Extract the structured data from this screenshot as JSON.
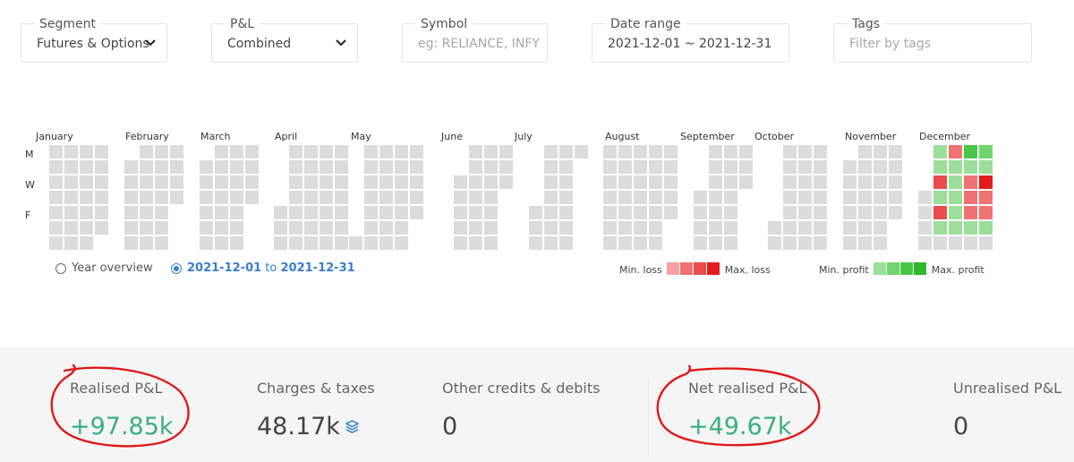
{
  "filters": {
    "segment": {
      "label": "Segment",
      "value": "Futures & Options"
    },
    "pnl": {
      "label": "P&L",
      "value": "Combined"
    },
    "symbol": {
      "label": "Symbol",
      "placeholder": "eg: RELIANCE, INFY"
    },
    "date_range": {
      "label": "Date range",
      "value": "2021-12-01 ~ 2021-12-31"
    },
    "tags": {
      "label": "Tags",
      "placeholder": "Filter by tags"
    }
  },
  "heatmap": {
    "months": [
      "January",
      "February",
      "March",
      "April",
      "May",
      "June",
      "July",
      "August",
      "September",
      "October",
      "November",
      "December"
    ],
    "day_labels": [
      "M",
      "W",
      "F"
    ],
    "empty_color": "#dcdcdc",
    "december_cells": [
      {
        "week": 1,
        "day": 0,
        "level": "p1"
      },
      {
        "week": 1,
        "day": 1,
        "level": "p1"
      },
      {
        "week": 1,
        "day": 2,
        "level": "l3"
      },
      {
        "week": 1,
        "day": 3,
        "level": "p1"
      },
      {
        "week": 1,
        "day": 4,
        "level": "l3"
      },
      {
        "week": 1,
        "day": 5,
        "level": "p1"
      },
      {
        "week": 2,
        "day": 0,
        "level": "l2"
      },
      {
        "week": 2,
        "day": 1,
        "level": "p1"
      },
      {
        "week": 2,
        "day": 2,
        "level": "p1"
      },
      {
        "week": 2,
        "day": 3,
        "level": "p1"
      },
      {
        "week": 2,
        "day": 4,
        "level": "p1"
      },
      {
        "week": 2,
        "day": 5,
        "level": "p1"
      },
      {
        "week": 3,
        "day": 0,
        "level": "p3"
      },
      {
        "week": 3,
        "day": 1,
        "level": "p1"
      },
      {
        "week": 3,
        "day": 2,
        "level": "l2"
      },
      {
        "week": 3,
        "day": 3,
        "level": "l2"
      },
      {
        "week": 3,
        "day": 4,
        "level": "l2"
      },
      {
        "week": 3,
        "day": 5,
        "level": "p1"
      },
      {
        "week": 4,
        "day": 0,
        "level": "p2"
      },
      {
        "week": 4,
        "day": 1,
        "level": "p1"
      },
      {
        "week": 4,
        "day": 2,
        "level": "l4"
      },
      {
        "week": 4,
        "day": 3,
        "level": "l2"
      },
      {
        "week": 4,
        "day": 4,
        "level": "l2"
      },
      {
        "week": 4,
        "day": 5,
        "level": "p1"
      },
      {
        "week": 5,
        "day": 0,
        "level": "p2"
      },
      {
        "week": 5,
        "day": 1,
        "level": "p1"
      },
      {
        "week": 5,
        "day": 2,
        "level": "l4"
      },
      {
        "week": 5,
        "day": 3,
        "level": "p1"
      },
      {
        "week": 5,
        "day": 4,
        "level": "p1"
      },
      {
        "week": 5,
        "day": 5,
        "level": "p1"
      }
    ],
    "colors": {
      "l1": "#f8a0a0",
      "l2": "#f07272",
      "l3": "#e84c4c",
      "l4": "#e31d1d",
      "p1": "#9bdf9b",
      "p2": "#6ed66e",
      "p3": "#46c846",
      "p4": "#2eb82e"
    }
  },
  "view": {
    "year_overview": "Year overview",
    "range_from": "2021-12-01",
    "range_to_word": "to",
    "range_to": "2021-12-31"
  },
  "legend": {
    "min_loss": "Min. loss",
    "max_loss": "Max. loss",
    "min_profit": "Min. profit",
    "max_profit": "Max. profit"
  },
  "summary": {
    "realised_pnl": {
      "label": "Realised P&L",
      "value": "+97.85k"
    },
    "charges": {
      "label": "Charges & taxes",
      "value": "48.17k"
    },
    "other": {
      "label": "Other credits & debits",
      "value": "0"
    },
    "net_realised": {
      "label": "Net realised P&L",
      "value": "+49.67k"
    },
    "unrealised": {
      "label": "Unrealised P&L",
      "value": "0"
    }
  },
  "colors": {
    "accent": "#387ed1",
    "profit_text": "#3aaf82",
    "annotation": "#e01818"
  }
}
